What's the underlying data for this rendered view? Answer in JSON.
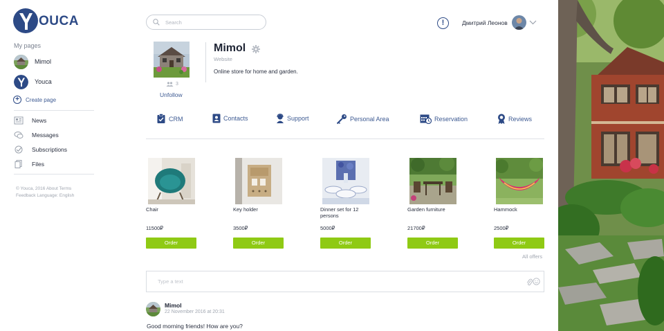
{
  "brand": {
    "name": "OUCA",
    "letter": "Y"
  },
  "sidebar": {
    "section_title": "My pages",
    "pages": [
      {
        "name": "Mimol"
      },
      {
        "name": "Youca"
      }
    ],
    "create_label": "Create page",
    "nav": [
      {
        "label": "News",
        "icon": "news-icon"
      },
      {
        "label": "Messages",
        "icon": "messages-icon"
      },
      {
        "label": "Subscriptions",
        "icon": "subscriptions-icon"
      },
      {
        "label": "Files",
        "icon": "files-icon"
      }
    ],
    "footer": {
      "copyright": "© Youca, 2016",
      "about": "About",
      "terms": "Terms",
      "feedback": "Feedback",
      "language_label": "Language:",
      "language": "English"
    }
  },
  "header": {
    "search_placeholder": "Search",
    "user_name": "Дмитрий Леонов"
  },
  "profile": {
    "title": "Mimol",
    "subtitle": "Website",
    "description": "Online store for home and garden.",
    "followers": "3",
    "unfollow_label": "Unfollow"
  },
  "tabs": [
    {
      "label": "CRM",
      "icon": "crm-icon"
    },
    {
      "label": "Contacts",
      "icon": "contacts-icon"
    },
    {
      "label": "Support",
      "icon": "support-icon"
    },
    {
      "label": "Personal Area",
      "icon": "key-icon"
    },
    {
      "label": "Reservation",
      "icon": "calendar-icon"
    },
    {
      "label": "Reviews",
      "icon": "award-icon"
    }
  ],
  "products": [
    {
      "name": "Chair",
      "price": "11500₽",
      "order_label": "Order"
    },
    {
      "name": "Key holder",
      "price": "3500₽",
      "order_label": "Order"
    },
    {
      "name": "Dinner set for 12 persons",
      "price": "5000₽",
      "order_label": "Order"
    },
    {
      "name": "Garden furniture",
      "price": "21700₽",
      "order_label": "Order"
    },
    {
      "name": "Hammock",
      "price": "2500₽",
      "order_label": "Order"
    }
  ],
  "all_offers_label": "All offers",
  "composer": {
    "placeholder": "Type a text"
  },
  "post": {
    "author": "Mimol",
    "date": "22 November 2016 at 20:31",
    "text": "Good morning friends! How are you?"
  },
  "colors": {
    "brand": "#2d4a86",
    "link": "#3d5a92",
    "order_button": "#8fca14"
  }
}
